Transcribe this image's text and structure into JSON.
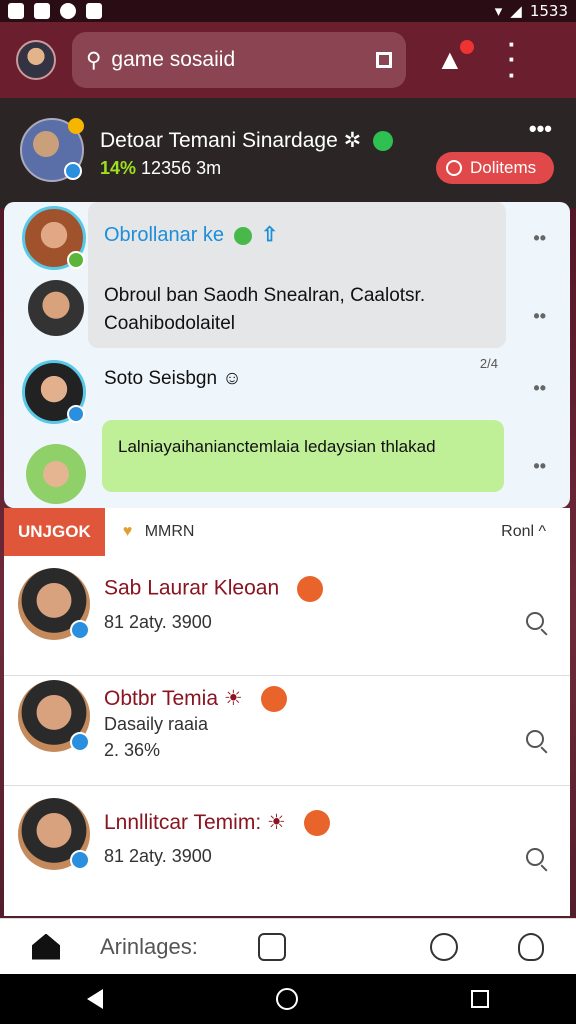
{
  "status_bar": {
    "time": "1533"
  },
  "app_bar": {
    "search_text": "game sosaiid"
  },
  "group_card": {
    "title": "Detoar Temani Sinardage",
    "stats_pct": "14%",
    "stats_rest": "12356 3m",
    "action_label": "Dolitems"
  },
  "chat": {
    "contact_name": "Obrollanar ke",
    "message_grey": "Obroul ban Saodh Snealran, Caalotsr. Coahibodolaitel",
    "contact2_name": "Soto Seisbgn",
    "time": "2/4",
    "message_green": "Lalniayaihanianctemlaia ledaysian thlakad"
  },
  "tab_header": {
    "active_tab": "UNJGOK",
    "filter": "MMRN",
    "sort": "Ronl ^"
  },
  "list": [
    {
      "name": "Sab Laurar Kleoan",
      "sub": "81 2aty. 3900"
    },
    {
      "name": "Obtbr Temia",
      "sub": "Dasaily raaia",
      "sub2": "2. 36%"
    },
    {
      "name": "Lnnllitcar Temim:",
      "sub": "81 2aty. 3900"
    }
  ],
  "bottom_nav": {
    "label": "Arinlages:"
  }
}
